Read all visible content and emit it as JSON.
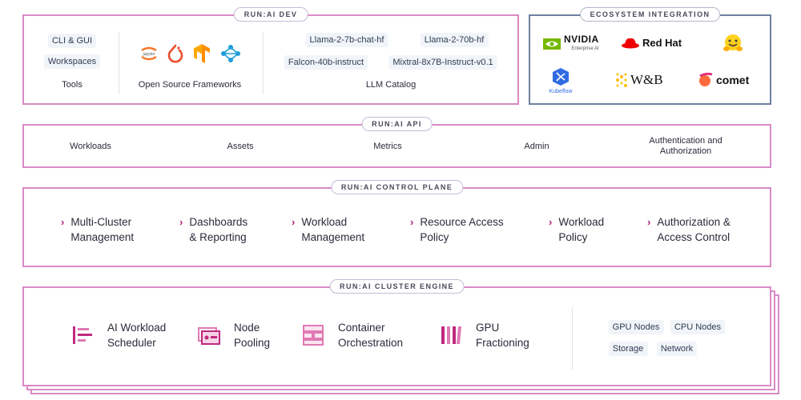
{
  "dev": {
    "title": "RUN:AI DEV",
    "tools": [
      "CLI & GUI",
      "Workspaces"
    ],
    "tools_label": "Tools",
    "frameworks_label": "Open Source Frameworks",
    "framework_icons": [
      "jupyter-icon",
      "pytorch-icon",
      "tensorflow-icon",
      "kubeflow-pipeline-icon"
    ],
    "jupyter_text": "jupyter",
    "llm_models": [
      "Llama-2-7b-chat-hf",
      "Llama-2-70b-hf",
      "Falcon-40b-instruct",
      "Mixtral-8x7B-Instruct-v0.1"
    ],
    "llm_label": "LLM Catalog"
  },
  "ecosystem": {
    "title": "ECOSYSTEM INTEGRATION",
    "nvidia": "NVIDIA",
    "nvidia_sub": "Enterprise AI",
    "redhat": "Red Hat",
    "kubeflow": "Kubeflow",
    "wandb": "W&B",
    "comet": "comet"
  },
  "api": {
    "title": "RUN:AI API",
    "items": [
      "Workloads",
      "Assets",
      "Metrics",
      "Admin",
      "Authentication and\nAuthorization"
    ]
  },
  "control_plane": {
    "title": "RUN:AI CONTROL PLANE",
    "items": [
      "Multi-Cluster\nManagement",
      "Dashboards\n& Reporting",
      "Workload\nManagement",
      "Resource Access\nPolicy",
      "Workload\nPolicy",
      "Authorization &\nAccess Control"
    ]
  },
  "cluster_engine": {
    "title": "RUN:AI CLUSTER ENGINE",
    "items": [
      "AI Workload\nScheduler",
      "Node\nPooling",
      "Container\nOrchestration",
      "GPU\nFractioning"
    ],
    "resources": [
      "GPU Nodes",
      "CPU Nodes",
      "Storage",
      "Network"
    ]
  },
  "colors": {
    "accent": "#a8267f",
    "border": "#d98ac6",
    "eco_border": "#6f7fa0"
  }
}
